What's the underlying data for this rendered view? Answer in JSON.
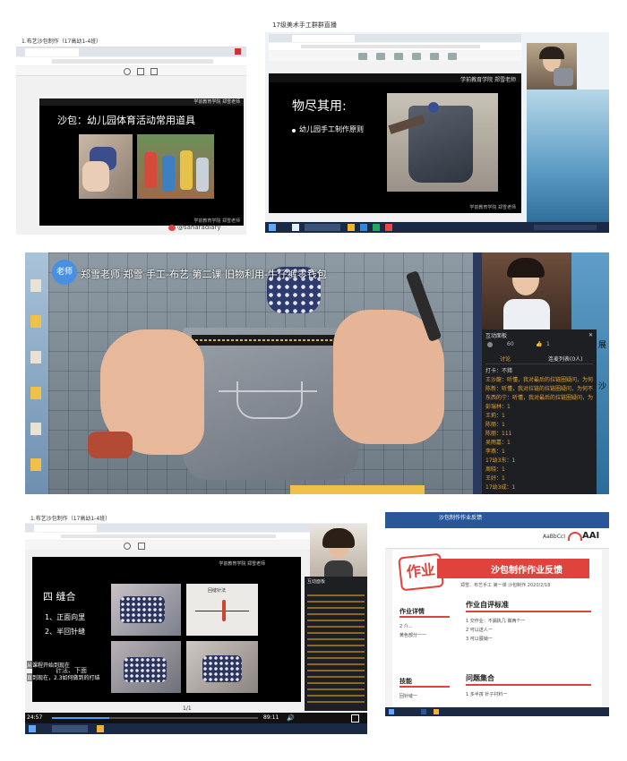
{
  "shot1": {
    "tab_title": "1.布艺沙包制作（17高幼1-4班）",
    "slide_title": "沙包：幼儿园体育活动常用道具",
    "college_label": "学前教育学院 郑雪老师",
    "watermark": "@saharadiary"
  },
  "shot2": {
    "window_title": "17级美术手工群群直播",
    "college_label": "学前教育学院 郑雪老师",
    "slide_title": "物尽其用:",
    "bullet": "幼儿园手工制作原则"
  },
  "shot3": {
    "badge": "老师",
    "stream_title": "郑雪老师 郑雪 手工-布艺 第二课 旧物利用-牛仔裤零钱包",
    "panel_title": "互动面板",
    "viewers": "60",
    "likes": "1",
    "tab_chat": "讨论",
    "tab_members": "连麦列表(0人)",
    "chat": [
      {
        "text": "打卡：不錯",
        "color": "white"
      },
      {
        "text": "王沙龍：听懂，我对最后的拉链圈疑问，为何不能",
        "color": "orange"
      },
      {
        "text": "陈新：听懂，我对拉链的拉链圈疑问，为何不能",
        "color": "orange"
      },
      {
        "text": "东西的宁：听懂，我对最后的拉链圈疑问，为何不能",
        "color": "orange"
      },
      {
        "text": "彭瑞林：1",
        "color": "orange"
      },
      {
        "text": "王莉：1",
        "color": "orange"
      },
      {
        "text": "陈丽：1",
        "color": "orange"
      },
      {
        "text": "陈丽：111",
        "color": "orange"
      },
      {
        "text": "吴雨嘉：1",
        "color": "orange"
      },
      {
        "text": "李燕：1",
        "color": "orange"
      },
      {
        "text": "17幼3东：1",
        "color": "orange"
      },
      {
        "text": "周晓：1",
        "color": "orange"
      },
      {
        "text": "王好：1",
        "color": "orange"
      },
      {
        "text": "17幼3成：1",
        "color": "orange"
      },
      {
        "text": "宋子：1",
        "color": "orange"
      }
    ],
    "side_chars": [
      "展",
      "沙"
    ]
  },
  "shot4": {
    "tab_title": "1.布艺沙包制作（17高幼1-4班）",
    "slide_title": "四 缝合",
    "steps": [
      "1、正面向里",
      "2、半回针缝"
    ],
    "steps_extra": "针法、下面",
    "college_label": "学前教育学院 郑雪老师",
    "inset_label": "回缝针法",
    "page_indicator": "1/1",
    "chat_overlay_1": "从课程开始到现在",
    "chat_overlay_2": "直到现在，2.3如何做到的打结",
    "time_current": "24:57",
    "time_total": "89:11",
    "panel_title": "互动面板"
  },
  "shot5": {
    "window_title": "沙包制作作业反馈",
    "stamp": "作业",
    "heading": "沙包制作作业反馈",
    "subheading": "郑雪、布艺手工 第一课 沙包制作 2020/2/18",
    "section_left_1": "作业详情",
    "left_lines_1": [
      "2 介...",
      "黄色部分一一"
    ],
    "section_left_2": "技能",
    "left_lines_2": [
      "回针缝一"
    ],
    "section_right_1": "作业自评标准",
    "criteria": [
      "1 交作业：不漏执几 做两个一",
      "2 可以送人一",
      "3 可以展销一"
    ],
    "section_right_2": "问题集合",
    "issues": [
      "1 多半孩 针子衬料一"
    ],
    "ribbon_labels": [
      "AaBbCcI",
      "AAI"
    ]
  },
  "colors": {
    "slide_bg": "#000000",
    "accent_red": "#e0433b",
    "chat_orange": "#e6a32c",
    "taskbar": "#1b2a44"
  }
}
